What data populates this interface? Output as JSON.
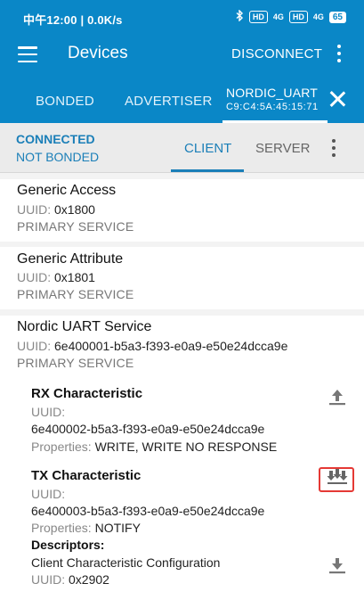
{
  "status_bar": {
    "left": "中午12:00 | 0.0K/s",
    "hd1": "HD",
    "sig1": "4G",
    "hd2": "HD",
    "sig2": "4G",
    "battery": "65"
  },
  "app_bar": {
    "title": "Devices",
    "disconnect_label": "DISCONNECT"
  },
  "tabs": {
    "bonded": "BONDED",
    "advertiser": "ADVERTISER",
    "device_name": "NORDIC_UART",
    "device_mac": "C9:C4:5A:45:15:71"
  },
  "connection": {
    "status": "CONNECTED",
    "bond_status": "NOT BONDED",
    "client_tab": "CLIENT",
    "server_tab": "SERVER"
  },
  "services": [
    {
      "name": "Generic Access",
      "uuid_label": "UUID:",
      "uuid": "0x1800",
      "type": "PRIMARY SERVICE"
    },
    {
      "name": "Generic Attribute",
      "uuid_label": "UUID:",
      "uuid": "0x1801",
      "type": "PRIMARY SERVICE"
    },
    {
      "name": "Nordic UART Service",
      "uuid_label": "UUID:",
      "uuid": "6e400001-b5a3-f393-e0a9-e50e24dcca9e",
      "type": "PRIMARY SERVICE",
      "characteristics": [
        {
          "name": "RX Characteristic",
          "uuid_label": "UUID:",
          "uuid": "6e400002-b5a3-f393-e0a9-e50e24dcca9e",
          "properties_label": "Properties:",
          "properties": "WRITE, WRITE NO RESPONSE",
          "icon": "upload-arrow-icon"
        },
        {
          "name": "TX Characteristic",
          "uuid_label": "UUID:",
          "uuid": "6e400003-b5a3-f393-e0a9-e50e24dcca9e",
          "properties_label": "Properties:",
          "properties": "NOTIFY",
          "icon": "notify-multi-download-icon",
          "descriptors_label": "Descriptors:",
          "descriptors": [
            {
              "name": "Client Characteristic Configuration",
              "uuid_label": "UUID:",
              "uuid": "0x2902",
              "icon": "download-arrow-icon"
            }
          ]
        }
      ]
    }
  ],
  "colors": {
    "primary": "#0a87c7",
    "accent": "#1b7fb8",
    "highlight": "#e53935"
  }
}
